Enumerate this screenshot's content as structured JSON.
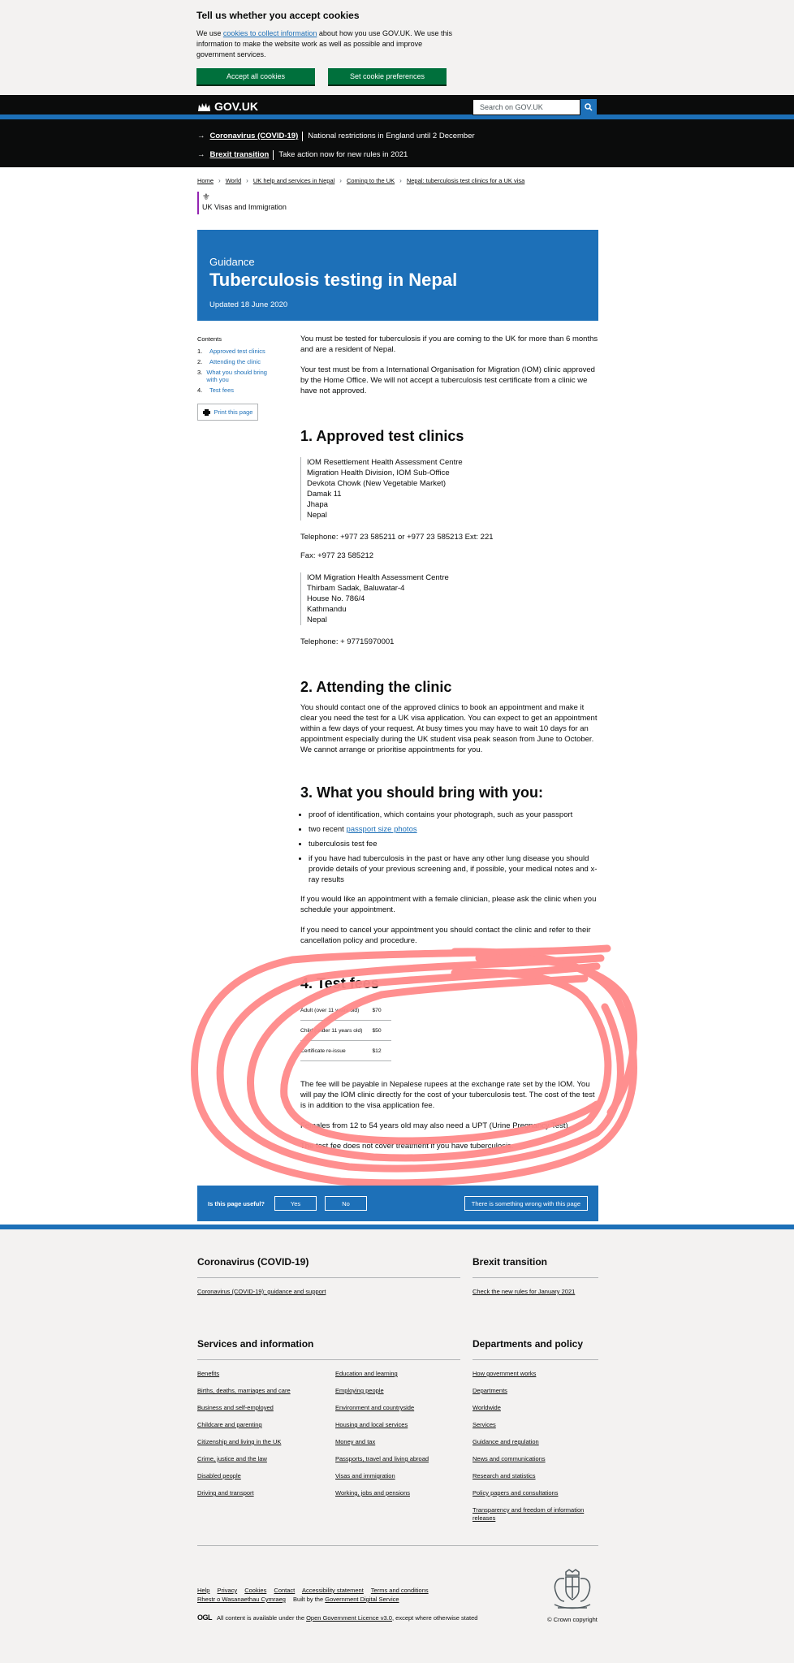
{
  "cookie_banner": {
    "title": "Tell us whether you accept cookies",
    "text_before": "We use ",
    "link": "cookies to collect information",
    "text_after": " about how you use GOV.UK. We use this information to make the website work as well as possible and improve government services.",
    "accept_label": "Accept all cookies",
    "preferences_label": "Set cookie preferences"
  },
  "header": {
    "logo": "GOV.UK",
    "search_placeholder": "Search on GOV.UK"
  },
  "notices": [
    {
      "link": "Coronavirus (COVID-19)",
      "text": "National restrictions in England until 2 December"
    },
    {
      "link": "Brexit transition",
      "text": "Take action now for new rules in 2021"
    }
  ],
  "breadcrumbs": [
    "Home",
    "World",
    "UK help and services in Nepal",
    "Coming to the UK",
    "Nepal: tuberculosis test clinics for a UK visa"
  ],
  "organisation": "UK Visas and Immigration",
  "title_block": {
    "kicker": "Guidance",
    "title": "Tuberculosis testing in Nepal",
    "updated": "Updated 18 June 2020"
  },
  "contents": {
    "title": "Contents",
    "items": [
      {
        "num": "1.",
        "label": "Approved test clinics"
      },
      {
        "num": "2.",
        "label": "Attending the clinic"
      },
      {
        "num": "3.",
        "label": "What you should bring with you"
      },
      {
        "num": "4.",
        "label": "Test fees"
      }
    ],
    "print_label": "Print this page"
  },
  "body": {
    "intro1": "You must be tested for tuberculosis if you are coming to the UK for more than 6 months and are a resident of Nepal.",
    "intro2": "Your test must be from a International Organisation for Migration (IOM) clinic approved by the Home Office. We will not accept a tuberculosis test certificate from a clinic we have not approved.",
    "s1_title": "1. Approved test clinics",
    "clinic1": [
      "IOM Resettlement Health Assessment Centre",
      "Migration Health Division, IOM Sub-Office",
      "Devkota Chowk (New Vegetable Market)",
      "Damak 11",
      "Jhapa",
      "Nepal"
    ],
    "clinic1_tel": "Telephone: +977 23 585211 or +977 23 585213 Ext: 221",
    "clinic1_fax": "Fax: +977 23 585212",
    "clinic2": [
      "IOM Migration Health Assessment Centre",
      "Thirbam Sadak, Baluwatar-4",
      "House No. 786/4",
      "Kathmandu",
      "Nepal"
    ],
    "clinic2_tel": "Telephone: + 97715970001",
    "s2_title": "2. Attending the clinic",
    "s2_text": "You should contact one of the approved clinics to book an appointment and make it clear you need the test for a UK visa application. You can expect to get an appointment within a few days of your request. At busy times you may have to wait 10 days for an appointment especially during the UK student visa peak season from June to October. We cannot arrange or prioritise appointments for you.",
    "s3_title": "3. What you should bring with you:",
    "bring_1": "proof of identification, which contains your photograph, such as your passport",
    "bring_2_pre": "two recent ",
    "bring_2_link": "passport size photos",
    "bring_3": "tuberculosis test fee",
    "bring_4": "if you have had tuberculosis in the past or have any other lung disease you should provide details of your previous screening and, if possible, your medical notes and x-ray results",
    "s3_p1": "If you would like an appointment with a female clinician, please ask the clinic when you schedule your appointment.",
    "s3_p2": "If you need to cancel your appointment you should contact the clinic and refer to their cancellation policy and procedure.",
    "s4_title": "4. Test fees",
    "fees": [
      {
        "label": "Adult (over 11 years old)",
        "value": "$70"
      },
      {
        "label": "Child (under 11 years old)",
        "value": "$50"
      },
      {
        "label": "Certificate re-issue",
        "value": "$12"
      }
    ],
    "s4_p1": "The fee will be payable in Nepalese rupees at the exchange rate set by the IOM. You will pay the IOM clinic directly for the cost of your tuberculosis test. The cost of the test is in addition to the visa application fee.",
    "s4_p2": "Females from 12 to 54 years old may also need a UPT (Urine Pregnancy Test).",
    "s4_p3": "The test fee does not cover treatment if you have tuberculosis."
  },
  "feedback": {
    "question": "Is this page useful?",
    "yes": "Yes",
    "no": "No",
    "wrong": "There is something wrong with this page"
  },
  "footer": {
    "covid": {
      "title": "Coronavirus (COVID-19)",
      "links": [
        "Coronavirus (COVID-19): guidance and support"
      ]
    },
    "brexit": {
      "title": "Brexit transition",
      "links": [
        "Check the new rules for January 2021"
      ]
    },
    "services": {
      "title": "Services and information",
      "col1": [
        "Benefits",
        "Births, deaths, marriages and care",
        "Business and self-employed",
        "Childcare and parenting",
        "Citizenship and living in the UK",
        "Crime, justice and the law",
        "Disabled people",
        "Driving and transport"
      ],
      "col2": [
        "Education and learning",
        "Employing people",
        "Environment and countryside",
        "Housing and local services",
        "Money and tax",
        "Passports, travel and living abroad",
        "Visas and immigration",
        "Working, jobs and pensions"
      ]
    },
    "departments": {
      "title": "Departments and policy",
      "links": [
        "How government works",
        "Departments",
        "Worldwide",
        "Services",
        "Guidance and regulation",
        "News and communications",
        "Research and statistics",
        "Policy papers and consultations",
        "Transparency and freedom of information releases"
      ]
    },
    "meta_links": [
      "Help",
      "Privacy",
      "Cookies",
      "Contact",
      "Accessibility statement",
      "Terms and conditions",
      "Rhestr o Wasanaethau Cymraeg"
    ],
    "built_by_pre": "Built by the ",
    "built_by_link": "Government Digital Service",
    "ogl": "OGL",
    "licence_pre": "All content is available under the ",
    "licence_link": "Open Government Licence v3.0",
    "licence_post": ", except where otherwise stated",
    "copyright": "© Crown copyright"
  },
  "colors": {
    "brand_blue": "#1d70b8",
    "button_green": "#00703c",
    "header_black": "#0b0c0c",
    "scribble": "#ff8a8a"
  }
}
